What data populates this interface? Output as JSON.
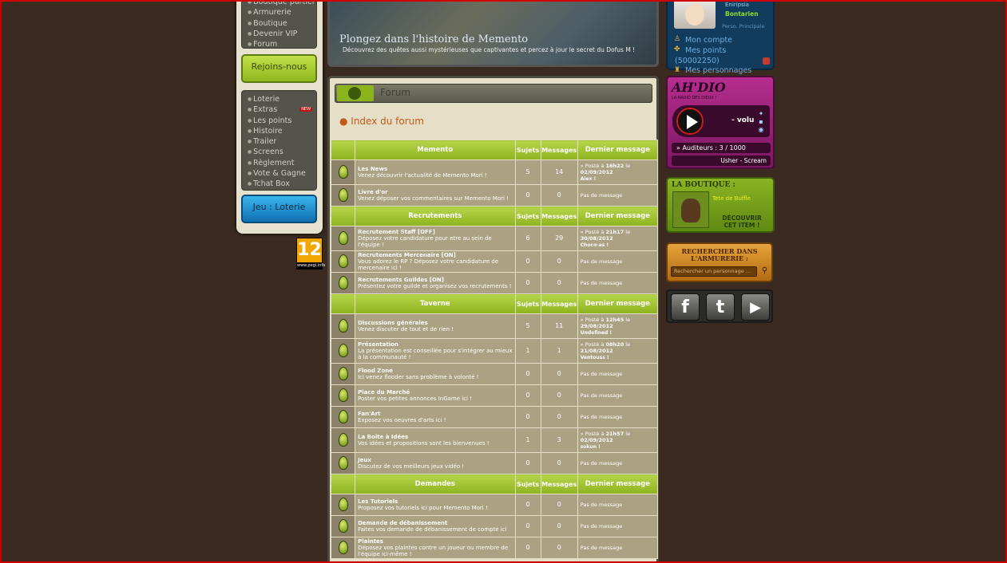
{
  "leftnav": {
    "top_items": [
      "Boutique partiel",
      "Armurerie",
      "Boutique",
      "Devenir VIP",
      "Forum"
    ],
    "join_button": "Rejoins-nous",
    "items": [
      "Loterie",
      "Extras",
      "Les points",
      "Histoire",
      "Trailer",
      "Screens",
      "Règlement",
      "Vote & Gagne",
      "Tchat Box"
    ],
    "new_badge": "NEW",
    "game_button": "Jeu : Loterie",
    "pegi_rating": "12",
    "pegi_site": "www.pegi.info"
  },
  "banner": {
    "title": "Plongez dans l'histoire de Memento",
    "subtitle": "Découvrez des quêtes aussi mystérieuses que captivantes et percez à jour le secret du Dofus M !"
  },
  "forum": {
    "header": "Forum",
    "index_link": "● Index du forum",
    "col_topics": "Sujets",
    "col_messages": "Messages",
    "col_last": "Dernier message",
    "sections": [
      {
        "name": "Memento",
        "rows": [
          {
            "title": "Les News",
            "desc": "Venez découvrir l'actualité de Memento Mori !",
            "topics": "5",
            "messages": "14",
            "last_pre": "» Posté à ",
            "last_time": "16h22",
            "last_mid": " le ",
            "last_date": "02/09/2012",
            "last_author": "Alex !"
          },
          {
            "title": "Livre d'or",
            "desc": "Venez déposer vos commentaires sur Memento Mori !",
            "topics": "0",
            "messages": "0",
            "last_none": "Pas de message"
          }
        ]
      },
      {
        "name": "Recrutements",
        "rows": [
          {
            "title": "Recrutement Staff [OFF]",
            "desc": "Déposez votre candidature pour etre au sein de l'équipe !",
            "topics": "6",
            "messages": "29",
            "last_pre": "» Posté à ",
            "last_time": "21h17",
            "last_mid": " le ",
            "last_date": "30/08/2012",
            "last_author": "Choco-as !"
          },
          {
            "title": "Recrutements Mercenaire [ON]",
            "desc": "Vous adorez le RP ? Déposez votre candidature de mercenaire ici !",
            "topics": "0",
            "messages": "0",
            "last_none": "Pas de message"
          },
          {
            "title": "Recrutements Guildes [ON]",
            "desc": "Présentez votre guilde et organisez vos recrutements !",
            "topics": "0",
            "messages": "0",
            "last_none": "Pas de message"
          }
        ]
      },
      {
        "name": "Taverne",
        "rows": [
          {
            "title": "Discussions générales",
            "desc": "Venez discuter de tout et de rien !",
            "topics": "5",
            "messages": "11",
            "last_pre": "» Posté à ",
            "last_time": "12h45",
            "last_mid": " le ",
            "last_date": "29/08/2012",
            "last_author": "Undefined !"
          },
          {
            "title": "Présentation",
            "desc": "La présentation est conseillée pour s'intégrer au mieux à la communauté !",
            "topics": "1",
            "messages": "1",
            "last_pre": "» Posté à ",
            "last_time": "08h20",
            "last_mid": " le ",
            "last_date": "21/08/2012",
            "last_author": "Ventouss !"
          },
          {
            "title": "Flood Zone",
            "desc": "Ici venez flooder sans problème à volonté !",
            "topics": "0",
            "messages": "0",
            "last_none": "Pas de message"
          },
          {
            "title": "Place du Marché",
            "desc": "Poster vos petites annonces InGame ici !",
            "topics": "0",
            "messages": "0",
            "last_none": "Pas de message"
          },
          {
            "title": "Fan'Art",
            "desc": "Exposez vos oeuvres d'arts ici !",
            "topics": "0",
            "messages": "0",
            "last_none": "Pas de message"
          },
          {
            "title": "La Boîte à Idées",
            "desc": "Vos idées et propositions sont les bienvenues !",
            "topics": "1",
            "messages": "3",
            "last_pre": "» Posté à ",
            "last_time": "21h57",
            "last_mid": " le ",
            "last_date": "02/09/2012",
            "last_author": "sokun !"
          },
          {
            "title": "Jeux",
            "desc": "Discutez de vos meilleurs jeux vidéo !",
            "topics": "0",
            "messages": "0",
            "last_none": "Pas de message"
          }
        ]
      },
      {
        "name": "Demandes",
        "rows": [
          {
            "title": "Les Tutoriels",
            "desc": "Proposez vos tutoriels ici pour Memento Mori !",
            "topics": "0",
            "messages": "0",
            "last_none": "Pas de message"
          },
          {
            "title": "Demande de débanissement",
            "desc": "Faites vos demande de débanissement de compte ici",
            "topics": "0",
            "messages": "0",
            "last_none": "Pas de message"
          },
          {
            "title": "Plaintes",
            "desc": "Déposez vos plaintes contre un joueur ou membre de l'équipe ici-même !",
            "topics": "0",
            "messages": "0",
            "last_none": "Pas de message"
          }
        ]
      }
    ]
  },
  "account": {
    "name1": "Eniripsia",
    "name2": "Bontarien",
    "perso_label": "Perso. Principale",
    "my_account": "Mon compte",
    "my_points": "Mes points",
    "points": "(50002250)",
    "my_chars": "Mes personnages"
  },
  "radio": {
    "logo": "AH'DIO",
    "tagline": "LA RADIO DES DIEUX !",
    "volume": "- volu",
    "listeners": "» Auditeurs : 3 / 1000",
    "server": "Usher - Scream"
  },
  "shop": {
    "title": "LA BOUTIQUE :",
    "product": "Tete de Buffle",
    "discover": "DÉCOUVRIR CET ITEM !"
  },
  "armory": {
    "title": "RECHERCHER DANS L'ARMURERIE :",
    "placeholder": "Rechercher un personnage ..."
  },
  "social": {
    "facebook": "f",
    "twitter": "t",
    "play": "▶"
  }
}
